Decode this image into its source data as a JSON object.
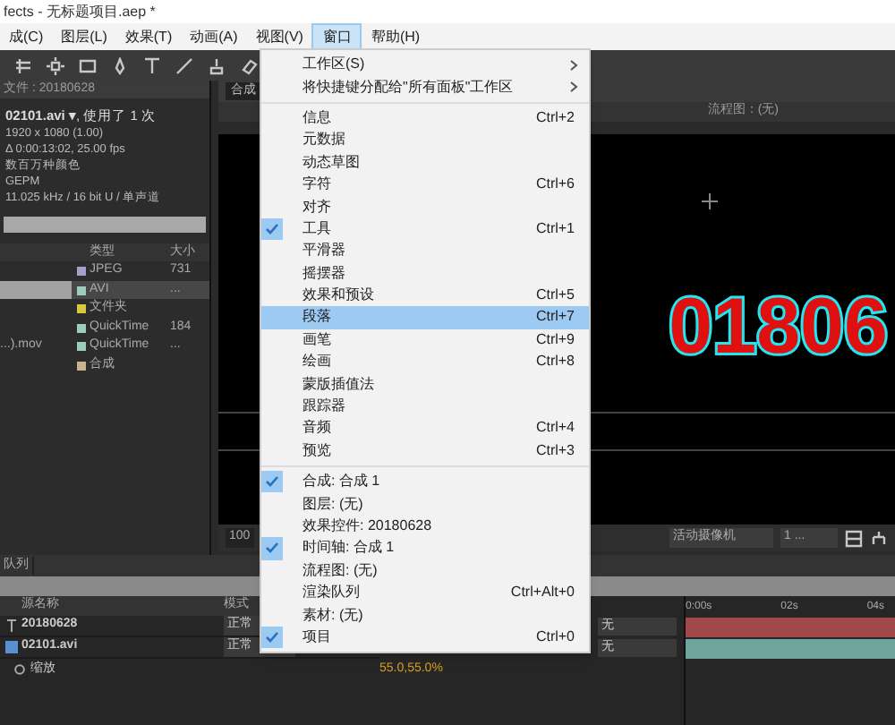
{
  "window": {
    "title": "fects - 无标题项目.aep *"
  },
  "menu_bar": [
    {
      "label": "成(C)",
      "selected": false
    },
    {
      "label": "图层(L)",
      "selected": false
    },
    {
      "label": "效果(T)",
      "selected": false
    },
    {
      "label": "动画(A)",
      "selected": false
    },
    {
      "label": "视图(V)",
      "selected": false
    },
    {
      "label": "窗口",
      "selected": true
    },
    {
      "label": "帮助(H)",
      "selected": false
    }
  ],
  "window_menu": {
    "sections": [
      [
        {
          "label": "工作区(S)",
          "submenu": true,
          "checked": false,
          "highlighted": false
        },
        {
          "label": "将快捷键分配给\"所有面板\"工作区",
          "submenu": true,
          "checked": false,
          "highlighted": false
        }
      ],
      [
        {
          "label": "信息",
          "shortcut": "Ctrl+2",
          "submenu": false,
          "checked": false,
          "highlighted": false
        },
        {
          "label": "元数据",
          "submenu": false,
          "checked": false,
          "highlighted": false
        },
        {
          "label": "动态草图",
          "submenu": false,
          "checked": false,
          "highlighted": false
        },
        {
          "label": "字符",
          "shortcut": "Ctrl+6",
          "submenu": false,
          "checked": false,
          "highlighted": false
        },
        {
          "label": "对齐",
          "submenu": false,
          "checked": false,
          "highlighted": false
        },
        {
          "label": "工具",
          "shortcut": "Ctrl+1",
          "submenu": false,
          "checked": true,
          "highlighted": false
        },
        {
          "label": "平滑器",
          "submenu": false,
          "checked": false,
          "highlighted": false
        },
        {
          "label": "摇摆器",
          "submenu": false,
          "checked": false,
          "highlighted": false
        },
        {
          "label": "效果和预设",
          "shortcut": "Ctrl+5",
          "submenu": false,
          "checked": false,
          "highlighted": false
        },
        {
          "label": "段落",
          "shortcut": "Ctrl+7",
          "submenu": false,
          "checked": false,
          "highlighted": true
        },
        {
          "label": "画笔",
          "shortcut": "Ctrl+9",
          "submenu": false,
          "checked": false,
          "highlighted": false
        },
        {
          "label": "绘画",
          "shortcut": "Ctrl+8",
          "submenu": false,
          "checked": false,
          "highlighted": false
        },
        {
          "label": "蒙版插值法",
          "submenu": false,
          "checked": false,
          "highlighted": false
        },
        {
          "label": "跟踪器",
          "submenu": false,
          "checked": false,
          "highlighted": false
        },
        {
          "label": "音频",
          "shortcut": "Ctrl+4",
          "submenu": false,
          "checked": false,
          "highlighted": false
        },
        {
          "label": "预览",
          "shortcut": "Ctrl+3",
          "submenu": false,
          "checked": false,
          "highlighted": false
        }
      ],
      [
        {
          "label": "合成: 合成 1",
          "submenu": false,
          "checked": true,
          "highlighted": false
        },
        {
          "label": "图层: (无)",
          "submenu": false,
          "checked": false,
          "highlighted": false
        },
        {
          "label": "效果控件: 20180628",
          "submenu": false,
          "checked": false,
          "highlighted": false
        },
        {
          "label": "时间轴: 合成 1",
          "submenu": false,
          "checked": true,
          "highlighted": false
        },
        {
          "label": "流程图: (无)",
          "submenu": false,
          "checked": false,
          "highlighted": false
        },
        {
          "label": "渲染队列",
          "shortcut": "Ctrl+Alt+0",
          "submenu": false,
          "checked": false,
          "highlighted": false
        },
        {
          "label": "素材: (无)",
          "submenu": false,
          "checked": false,
          "highlighted": false
        },
        {
          "label": "项目",
          "shortcut": "Ctrl+0",
          "submenu": false,
          "checked": true,
          "highlighted": false
        }
      ]
    ]
  },
  "project_panel": {
    "title": "文件 : 20180628",
    "footage": {
      "name": "02101.avi ▾",
      "usage": ", 使用了 1 次",
      "details": [
        "1920 x 1080 (1.00)",
        "Δ 0:00:13:02, 25.00 fps",
        "数百万种颜色",
        "GEPM",
        "11.025 kHz / 16 bit U / 单声道"
      ]
    },
    "columns": [
      "类型",
      "大小"
    ],
    "rows": [
      {
        "type": "JPEG",
        "size": "731",
        "color": "#a6a0c8",
        "selected": false
      },
      {
        "type": "AVI",
        "size": "...",
        "color": "#9ccbc0",
        "selected": true
      },
      {
        "type": "文件夹",
        "color": "#d8c840",
        "selected": false
      },
      {
        "type": "QuickTime",
        "size": "184",
        "color": "#9ccbc0",
        "selected": false
      },
      {
        "name": "...).mov",
        "type": "QuickTime",
        "size": "...",
        "color": "#9ccbc0",
        "selected": false
      },
      {
        "type": "合成",
        "color": "#c8b48c",
        "selected": false
      }
    ]
  },
  "viewer": {
    "tab": "合成",
    "flow_label": "流程图：(无)",
    "composition_text": "01806",
    "zoom": "100",
    "camera": "活动摄像机",
    "views": "1 ..."
  },
  "timeline": {
    "tab": "队列",
    "columns": [
      "源名称",
      "模式"
    ],
    "layers": [
      {
        "name": "20180628",
        "kind": "text",
        "mode": "正常",
        "matte": "无",
        "color": "#a0484c"
      },
      {
        "name": "02101.avi",
        "kind": "footage",
        "mode": "正常",
        "matte": "无",
        "color": "#6fa49c"
      }
    ],
    "property": {
      "name": "缩放",
      "value": "55.0,55.0%"
    },
    "ruler": [
      "0:00s",
      "02s",
      "04s"
    ]
  }
}
